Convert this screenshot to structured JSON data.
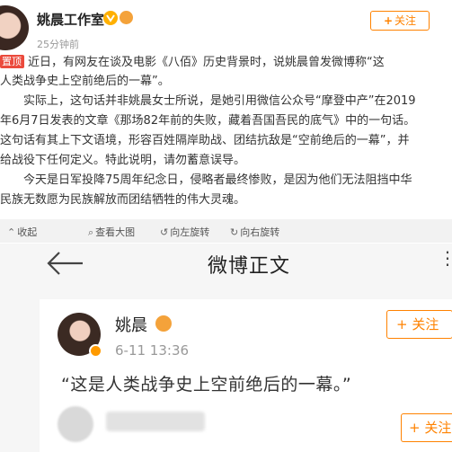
{
  "post": {
    "author": "姚晨工作室",
    "time": "25分钟前",
    "follow_label": "关注",
    "pin_label": "置顶",
    "lines": [
      "近日，有网友在谈及电影《八佰》历史背景时，说姚晨曾发微博称“这",
      "人类战争史上空前绝后的一幕”。",
      "　　实际上，这句话并非姚晨女士所说，是她引用微信公众号“摩登中产”在2019",
      "年6月7日发表的文章《那场82年前的失败，藏着吾国吾民的底气》中的一句话。",
      "这句话有其上下文语境，形容百姓隔岸助战、团结抗敌是“空前绝后的一幕”，并",
      "给战役下任何定义。特此说明，请勿蓄意误导。",
      "　　今天是日军投降75周年纪念日，侵略者最终惨败，是因为他们无法阻挡中华",
      "民族无数愿为民族解放而团结牺牲的伟大灵魂。"
    ]
  },
  "toolbar": {
    "collapse": "收起",
    "view_large": "查看大图",
    "rotate_left": "向左旋转",
    "rotate_right": "向右旋转"
  },
  "screenshot": {
    "nav_title": "微博正文",
    "author": "姚晨",
    "time": "6-11 13:36",
    "follow_label": "+ 关注",
    "quote": "“这是人类战争史上空前绝后的一幕。”",
    "follow_label_2": "+ 关注"
  }
}
